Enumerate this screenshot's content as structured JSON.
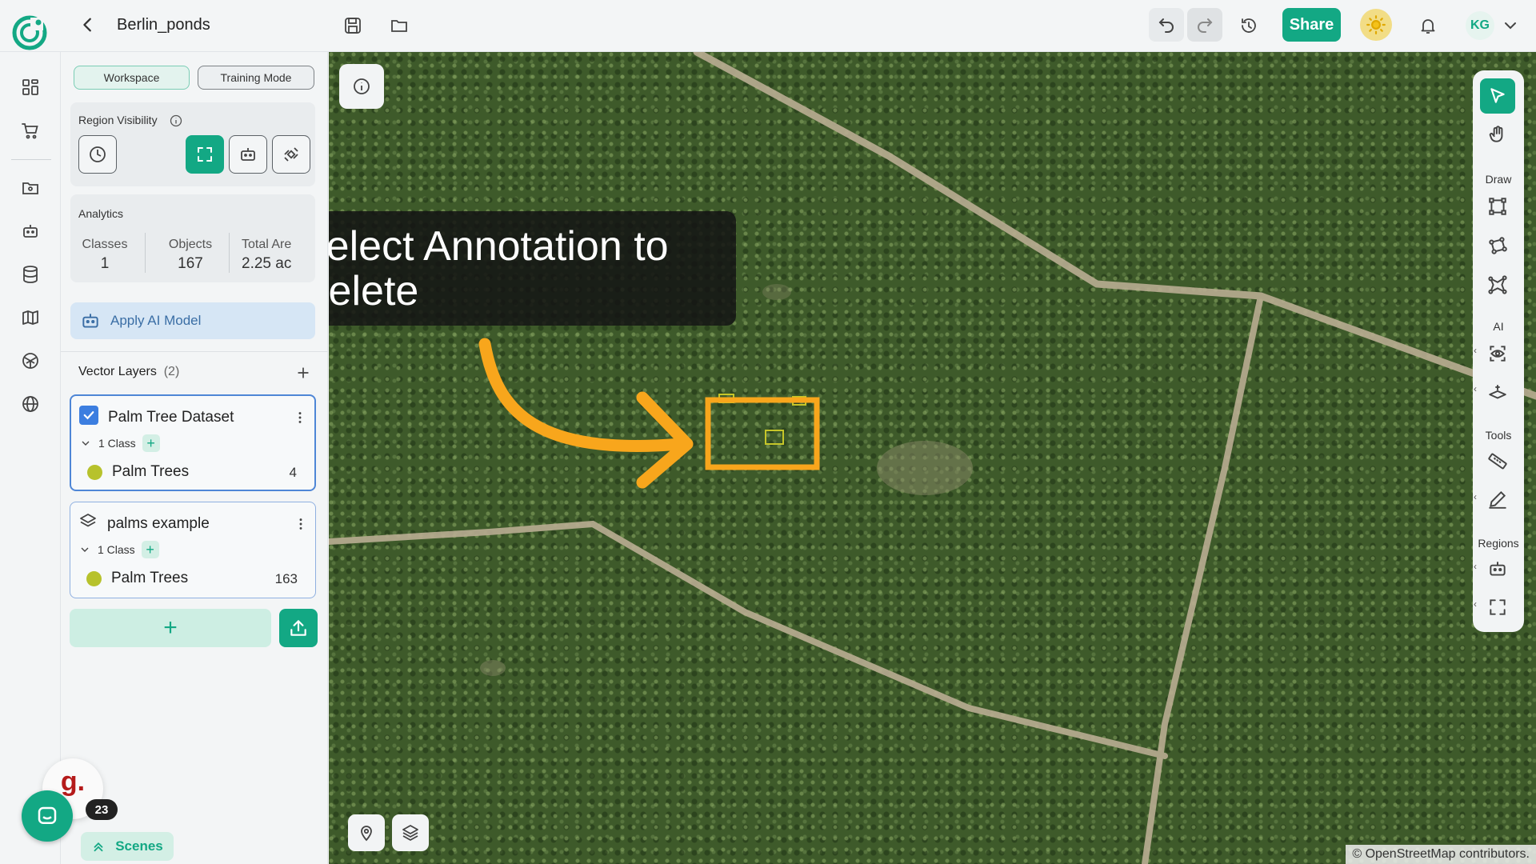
{
  "header": {
    "project_title": "Berlin_ponds",
    "share_label": "Share",
    "avatar_initials": "KG"
  },
  "panel": {
    "mode_workspace": "Workspace",
    "mode_training": "Training Mode",
    "region_visibility_label": "Region Visibility",
    "analytics_label": "Analytics",
    "stats": {
      "classes_label": "Classes",
      "classes_value": "1",
      "objects_label": "Objects",
      "objects_value": "167",
      "total_area_label": "Total Are",
      "total_area_value": "2.25 ac"
    },
    "apply_ai_label": "Apply AI Model",
    "vector_layers_title": "Vector Layers",
    "vector_layers_count": "(2)",
    "layers": [
      {
        "name": "Palm Tree Dataset",
        "class_count_label": "1 Class",
        "class_name": "Palm Trees",
        "object_count": "4"
      },
      {
        "name": "palms example",
        "class_count_label": "1 Class",
        "class_name": "Palm Trees",
        "object_count": "163"
      }
    ],
    "add_symbol": "+",
    "scenes_label": "Scenes"
  },
  "floating": {
    "g_logo": "g.",
    "notification_count": "23"
  },
  "map": {
    "tooltip_text": "Select Annotation to Delete",
    "attribution": "© OpenStreetMap contributors.",
    "annotation_color": "#f8a61c",
    "feature_color": "#c6c629"
  },
  "right_toolbar": {
    "draw_label": "Draw",
    "ai_label": "AI",
    "tools_label": "Tools",
    "regions_label": "Regions"
  },
  "colors": {
    "accent": "#13a884",
    "selection_blue": "#3c7ee0",
    "class_dot": "#b7c22c"
  }
}
